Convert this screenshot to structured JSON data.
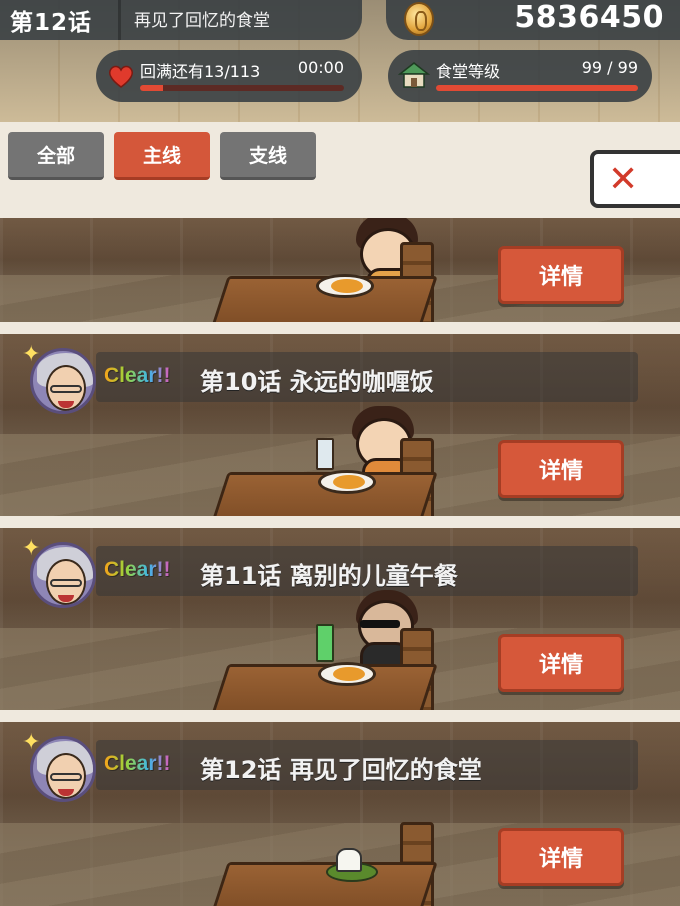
{
  "header": {
    "episode_number": "第12话",
    "episode_title": "再见了回忆的食堂",
    "money": "5836450",
    "stamina_label": "回满还有13/113",
    "stamina_timer": "00:00",
    "stamina_fraction": 0.115,
    "restaurant_level_label": "食堂等级",
    "restaurant_level_value": "99 / 99",
    "restaurant_level_fraction": 1.0
  },
  "tabs": [
    {
      "label": "全部",
      "active": false
    },
    {
      "label": "主线",
      "active": true
    },
    {
      "label": "支线",
      "active": false
    }
  ],
  "close_label": "✕",
  "stories": [
    {
      "title": "",
      "cleared": false,
      "details_label": "详情"
    },
    {
      "title": "第10话 永远的咖喱饭",
      "cleared": true,
      "clear_text": "Clear!!",
      "details_label": "详情"
    },
    {
      "title": "第11话 离别的儿童午餐",
      "cleared": true,
      "clear_text": "Clear!!",
      "details_label": "详情"
    },
    {
      "title": "第12话 再见了回忆的食堂",
      "cleared": true,
      "clear_text": "Clear!!",
      "details_label": "详情"
    }
  ],
  "colors": {
    "accent": "#d6583a",
    "tab_inactive": "#747474",
    "bar_fill": "#e24a34",
    "pill_bg": "#373e42"
  }
}
